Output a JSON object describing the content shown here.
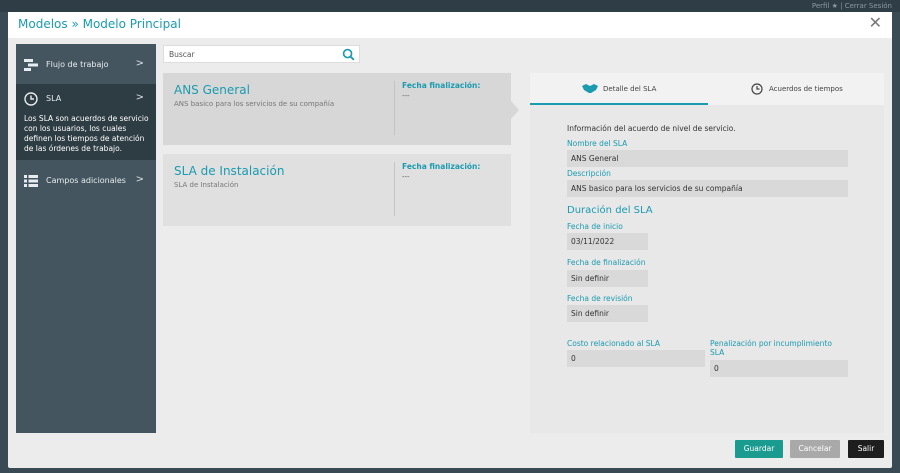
{
  "background": {
    "top_right_text": "Perfil  ★  |  Cerrar Sesión"
  },
  "modal": {
    "title": "Modelos » Modelo Principal",
    "close_glyph": "✕"
  },
  "sidebar": {
    "items": [
      {
        "label": "Flujo de trabajo",
        "icon": "workflow-icon"
      },
      {
        "label": "SLA",
        "icon": "clock-icon",
        "description": "Los SLA son acuerdos de servicio con los usuarios, los cuales definen los tiempos de atención de las órdenes de trabajo."
      },
      {
        "label": "Campos adicionales",
        "icon": "list-icon"
      }
    ]
  },
  "search": {
    "placeholder": "Buscar"
  },
  "sla_cards": [
    {
      "title": "ANS General",
      "subtitle": "ANS basico para los servicios de su compañía",
      "date_label": "Fecha finalización:",
      "date_value": "---"
    },
    {
      "title": "SLA de Instalación",
      "subtitle": "SLA de Instalación",
      "date_label": "Fecha finalización:",
      "date_value": "---"
    }
  ],
  "detail": {
    "tabs": [
      {
        "label": "Detalle del SLA",
        "icon": "handshake-icon"
      },
      {
        "label": "Acuerdos de tiempos",
        "icon": "clock-icon"
      }
    ],
    "info_text": "Información del acuerdo de nivel de servicio.",
    "name_label": "Nombre del SLA",
    "name_value": "ANS General",
    "desc_label": "Descripción",
    "desc_value": "ANS basico para los servicios de su compañía",
    "duration_title": "Duración del SLA",
    "start_label": "Fecha de inicio",
    "start_value": "03/11/2022",
    "end_label": "Fecha de finalización",
    "end_value": "Sin definir",
    "review_label": "Fecha de revisión",
    "review_value": "Sin definir",
    "cost_label": "Costo relacionado al SLA",
    "cost_value": "0",
    "penalty_label": "Penalización por incumplimiento SLA",
    "penalty_value": "0"
  },
  "buttons": {
    "save": "Guardar",
    "cancel": "Cancelar",
    "exit": "Salir"
  },
  "colors": {
    "accent": "#1a9bb0",
    "sidebar": "#44555f",
    "save_button": "#1a9b8f",
    "cancel_button": "#a9a9a9",
    "exit_button": "#1e1e1e"
  }
}
